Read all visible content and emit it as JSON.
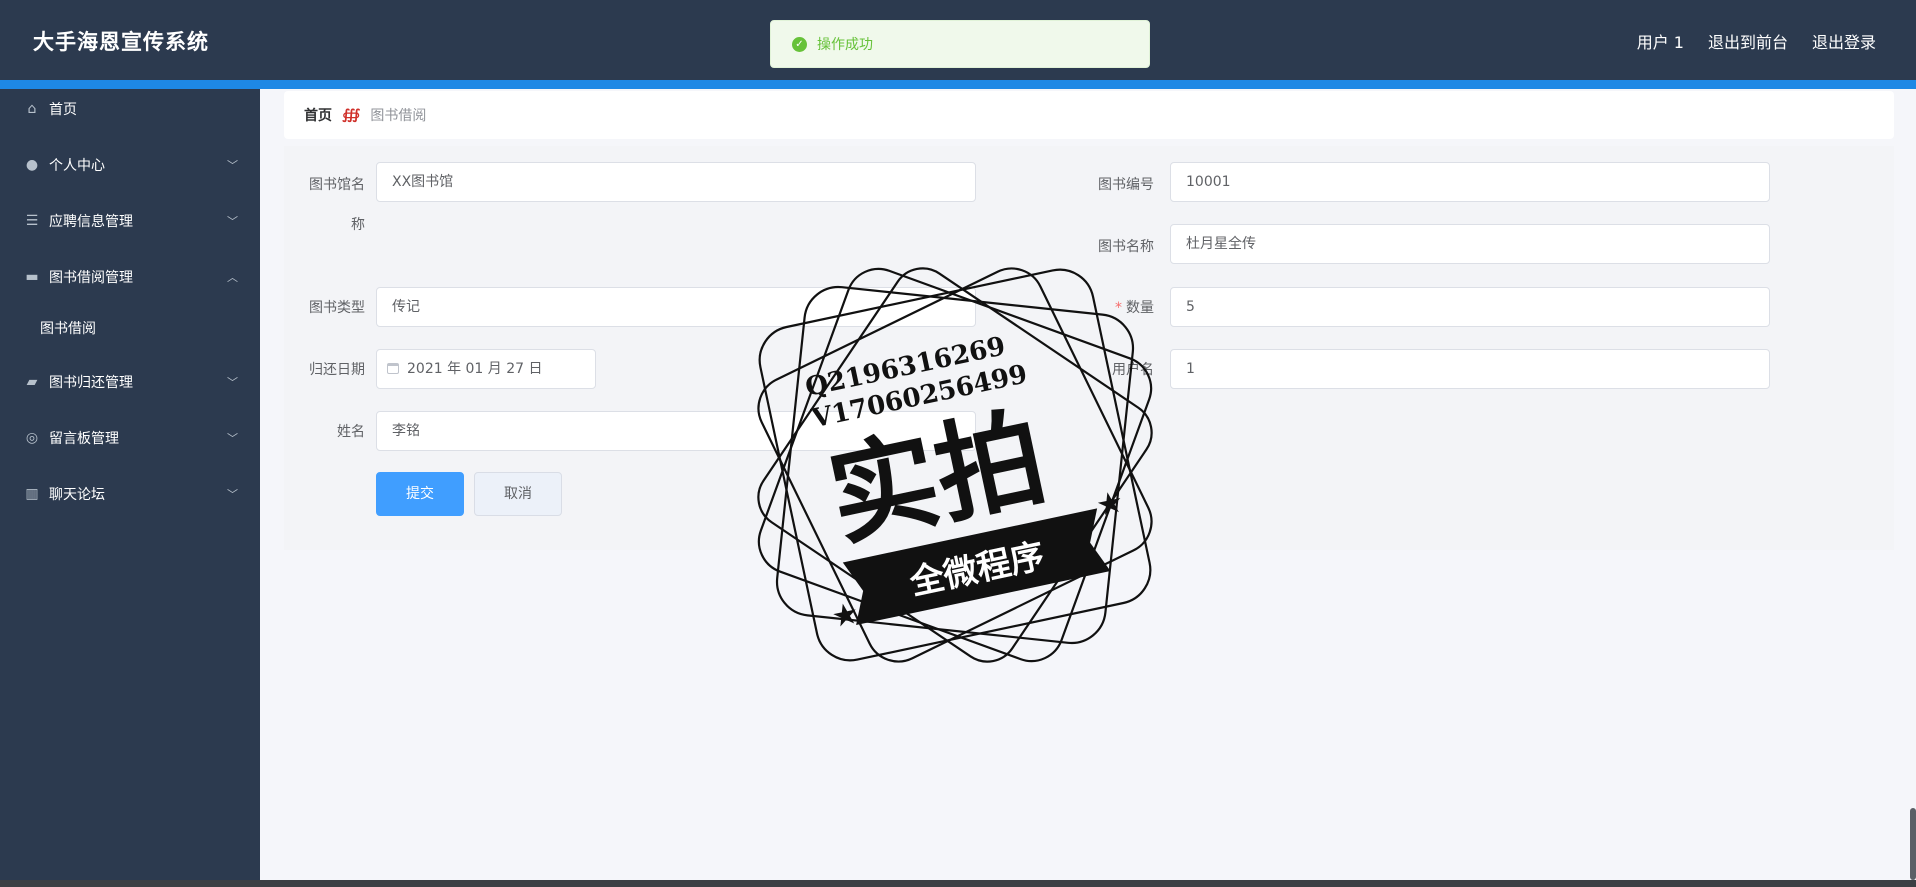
{
  "header": {
    "brand": "大手海恩宣传系统",
    "nav": [
      "用户 1",
      "退出到前台",
      "退出登录"
    ]
  },
  "toast": {
    "message": "操作成功"
  },
  "sidebar": {
    "items": [
      {
        "label": "首页",
        "icon": "home-icon"
      },
      {
        "label": "个人中心",
        "icon": "user-icon",
        "expanded": false
      },
      {
        "label": "应聘信息管理",
        "icon": "list-icon",
        "expanded": false
      },
      {
        "label": "图书借阅管理",
        "icon": "briefcase-icon",
        "expanded": true,
        "children": [
          "图书借阅"
        ]
      },
      {
        "label": "图书归还管理",
        "icon": "ticket-icon",
        "expanded": false
      },
      {
        "label": "留言板管理",
        "icon": "compass-icon",
        "expanded": false
      },
      {
        "label": "聊天论坛",
        "icon": "chart-icon",
        "expanded": false
      }
    ]
  },
  "breadcrumb": {
    "home": "首页",
    "current": "图书借阅"
  },
  "form": {
    "library_name": {
      "label_1": "图书馆名",
      "label_2": "称",
      "value": "XX图书馆"
    },
    "book_no": {
      "label": "图书编号",
      "value": "10001"
    },
    "book_name": {
      "label": "图书名称",
      "value": "杜月星全传"
    },
    "book_type": {
      "label": "图书类型",
      "value": "传记"
    },
    "quantity": {
      "label": "数量",
      "required_mark": "*",
      "value": "5"
    },
    "return_date": {
      "label": "归还日期",
      "value": "2021 年 01 月 27 日"
    },
    "username": {
      "label": "用户名",
      "value": "1"
    },
    "real_name": {
      "label": "姓名",
      "value": "李铭"
    },
    "submit_label": "提交",
    "cancel_label": "取消"
  },
  "watermark": {
    "line1": "Q2196316269",
    "line2": "V17060256499",
    "main": "实拍",
    "banner": "全微程序"
  },
  "colors": {
    "header_bg": "#2c3a4f",
    "accent_line": "#1e88e5",
    "primary_button": "#409eff",
    "success": "#67c23a"
  }
}
